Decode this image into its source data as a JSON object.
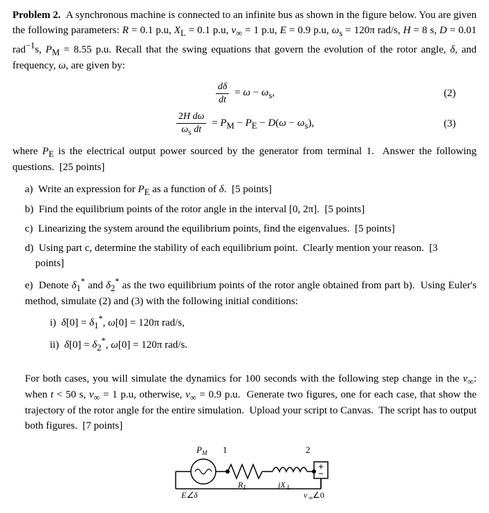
{
  "problem": {
    "label": "Problem 2.",
    "intro": " A synchronous machine is connected to an infinite bus as shown in the figure below. You are given the following parameters: R = 0.1 p.u, X",
    "intro2": " = 0.1 p.u, v",
    "intro3": " = 1 p.u, E = 0.9 p.u, ω",
    "intro4": " = 120π rad/s, H = 8 s, D = 0.01 rad",
    "intro5": "s, P",
    "intro6": " = 8.55 p.u. Recall that the swing equations that govern the evolution of the rotor angle, δ, and frequency, ω, are given by:",
    "eq2_label": "(2)",
    "eq3_label": "(3)",
    "where_text": "where P",
    "where_text2": " is the electrical output power sourced by the generator from terminal 1.  Answer the following questions.  [25 points]",
    "questions": [
      {
        "letter": "a)",
        "text": "Write an expression for P",
        "text2": " as a function of δ.  [5 points]"
      },
      {
        "letter": "b)",
        "text": "Find the equilibrium points of the rotor angle in the interval [0, 2π].  [5 points]"
      },
      {
        "letter": "c)",
        "text": "Linearizing the system around the equilibrium points, find the eigenvalues.  [5 points]"
      },
      {
        "letter": "d)",
        "text": "Using part c, determine the stability of each equilibrium point.  Clearly mention your reason.  [3 points]"
      },
      {
        "letter": "e)",
        "text_intro": "Denote δ",
        "text_mid": " and δ",
        "text_mid2": " as the two equilibrium points of the rotor angle obtained from part b).  Using Euler's method, simulate (2) and (3) with the following initial conditions:",
        "sub_items": [
          {
            "label": "i)",
            "text": "δ[0] = δ",
            "text2": ", ω[0] = 120π rad/s,"
          },
          {
            "label": "ii)",
            "text": "δ[0] = δ",
            "text2": ", ω[0] = 120π rad/s."
          }
        ],
        "footer": "For both cases, you will simulate the dynamics for 100 seconds with the following step change in the v",
        "footer2": ": when t < 50 s, v",
        "footer3": " = 1 p.u, otherwise, v",
        "footer4": " = 0.9 p.u.  Generate two figures, one for each case, that show the trajectory of the rotor angle for the entire simulation.  Upload your script to Canvas.  The script has to output both figures.  [7 points]"
      }
    ],
    "circuit": {
      "node1": "P_M",
      "node2": "1",
      "node3": "2",
      "label_RL": "R_L",
      "label_jXL": "jX_L",
      "label_E": "E∠δ",
      "label_vinf": "v∞∠0"
    }
  }
}
